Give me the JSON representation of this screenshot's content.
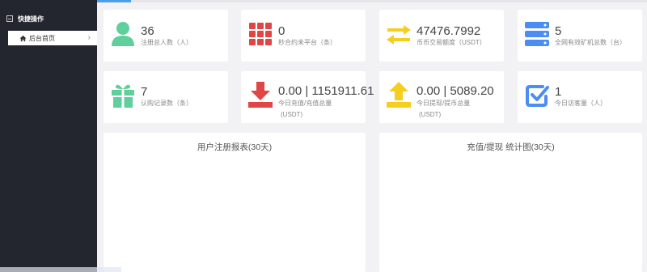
{
  "sidebar": {
    "section_title": "快捷操作",
    "items": [
      {
        "label": "后台首页"
      }
    ]
  },
  "stats_row1": [
    {
      "value": "36",
      "label": "注册总人数（人）",
      "icon": "person-icon",
      "color": "#5fcf9c"
    },
    {
      "value": "0",
      "label": "秒合约未平台（条）",
      "icon": "grid-icon",
      "color": "#e04646"
    },
    {
      "value": "47476.7992",
      "label": "币币交易额度（USDT）",
      "icon": "exchange-arrows-icon",
      "color": "#f5cf1f"
    },
    {
      "value": "5",
      "label": "全网有效矿机总数（台）",
      "icon": "server-icon",
      "color": "#4b8df2"
    }
  ],
  "stats_row2": [
    {
      "value": "7",
      "label": "认购记录数（条）",
      "icon": "gift-icon",
      "color": "#5fcf9c"
    },
    {
      "value": "0.00 | 1151911.61",
      "label": "今日充值/充值总量",
      "label2": "(USDT)",
      "icon": "download-icon",
      "color": "#e04646"
    },
    {
      "value": "0.00 | 5089.20",
      "label": "今日提现/提币总量",
      "label2": "(USDT)",
      "icon": "upload-icon",
      "color": "#f5cf1f"
    },
    {
      "value": "1",
      "label": "今日访客量（人）",
      "icon": "checkbox-icon",
      "color": "#4b8df2"
    }
  ],
  "panels": [
    {
      "title": "用户注册报表(30天)"
    },
    {
      "title": "充值/提现 统计图(30天)"
    }
  ]
}
